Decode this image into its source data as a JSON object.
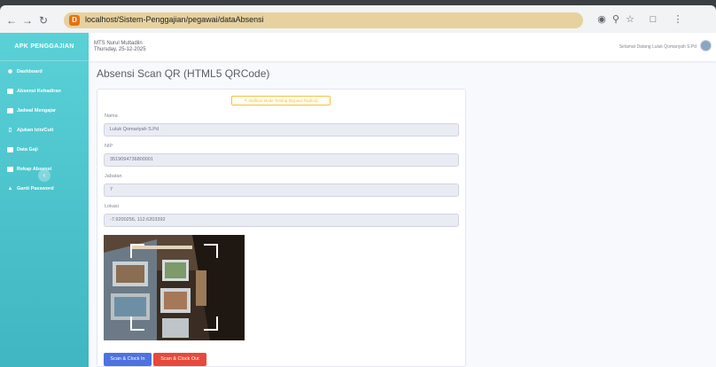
{
  "browser": {
    "url": "localhost/Sistem-Penggajian/pegawai/dataAbsensi"
  },
  "sidebar": {
    "brand": "APK PENGGAJIAN",
    "items": [
      {
        "label": "Dashboard",
        "icon": "gauge-icon"
      },
      {
        "label": "Absensi Kehadiran",
        "icon": "absensi-icon"
      },
      {
        "label": "Jadwal Mengajar",
        "icon": "calendar-icon"
      },
      {
        "label": "Ajukan Izin/Cuti",
        "icon": "file-icon"
      },
      {
        "label": "Data Gaji",
        "icon": "money-icon"
      },
      {
        "label": "Rekap Absensi",
        "icon": "report-icon"
      },
      {
        "label": "Ganti Password",
        "icon": "lock-icon"
      }
    ]
  },
  "topbar": {
    "school": "MTS Nurul Muttadlin",
    "date": "Thursday, 25-12-2025",
    "welcome": "Selamat Datang Luluk Qomariyah S.Pd"
  },
  "page": {
    "title": "Absensi Scan QR (HTML5 QRCode)",
    "test_mode_label": "Aktifkan Mode Testing (Bypass Radius)",
    "fields": [
      {
        "label": "Nama",
        "value": "Luluk Qomariyah S.Pd"
      },
      {
        "label": "NIP",
        "value": "3519094736800001"
      },
      {
        "label": "Jabatan",
        "value": "7"
      },
      {
        "label": "Lokasi",
        "value": "-7.9200256, 112.6203392"
      }
    ],
    "clock_in_label": "Scan & Clock In",
    "clock_out_label": "Scan & Clock Out"
  },
  "colors": {
    "sidebar": "#3fb6c1",
    "primary": "#4e73df",
    "danger": "#e74a3b",
    "warning": "#f6c23e"
  }
}
